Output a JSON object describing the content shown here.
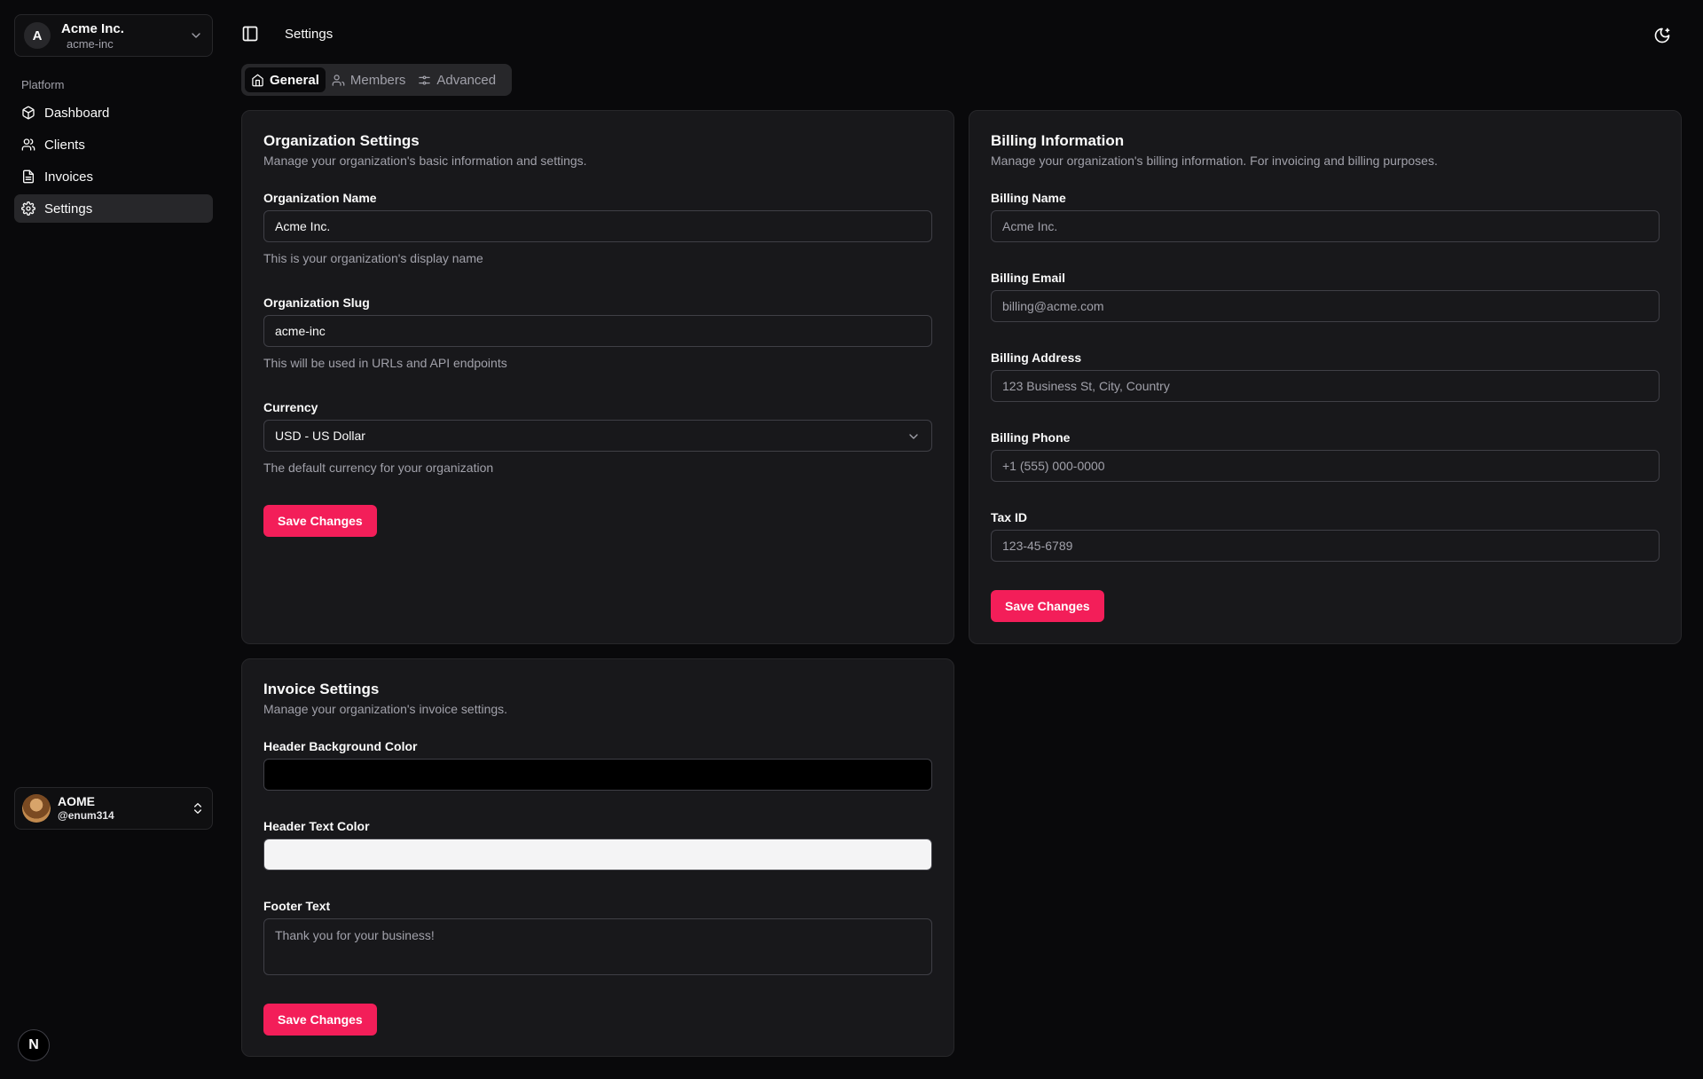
{
  "org": {
    "initial": "A",
    "name": "Acme Inc.",
    "slug": "acme-inc"
  },
  "sidebar": {
    "group_label": "Platform",
    "items": [
      {
        "label": "Dashboard",
        "icon": "box-icon"
      },
      {
        "label": "Clients",
        "icon": "users-icon"
      },
      {
        "label": "Invoices",
        "icon": "file-text-icon"
      },
      {
        "label": "Settings",
        "icon": "gear-icon",
        "active": true
      }
    ]
  },
  "user": {
    "name": "AOME",
    "handle": "@enum314"
  },
  "next_badge": "N",
  "header": {
    "title": "Settings"
  },
  "tabs": [
    {
      "label": "General",
      "icon": "home-icon",
      "active": true
    },
    {
      "label": "Members",
      "icon": "user-icon"
    },
    {
      "label": "Advanced",
      "icon": "sliders-icon"
    }
  ],
  "org_settings": {
    "title": "Organization Settings",
    "description": "Manage your organization's basic information and settings.",
    "name_label": "Organization Name",
    "name_value": "Acme Inc.",
    "name_help": "This is your organization's display name",
    "slug_label": "Organization Slug",
    "slug_value": "acme-inc",
    "slug_help": "This will be used in URLs and API endpoints",
    "currency_label": "Currency",
    "currency_value": "USD - US Dollar",
    "currency_help": "The default currency for your organization",
    "save_label": "Save Changes"
  },
  "billing": {
    "title": "Billing Information",
    "description": "Manage your organization's billing information. For invoicing and billing purposes.",
    "name_label": "Billing Name",
    "name_placeholder": "Acme Inc.",
    "email_label": "Billing Email",
    "email_placeholder": "billing@acme.com",
    "address_label": "Billing Address",
    "address_placeholder": "123 Business St, City, Country",
    "phone_label": "Billing Phone",
    "phone_placeholder": "+1 (555) 000-0000",
    "tax_label": "Tax ID",
    "tax_placeholder": "123-45-6789",
    "save_label": "Save Changes"
  },
  "invoice": {
    "title": "Invoice Settings",
    "description": "Manage your organization's invoice settings.",
    "header_bg_label": "Header Background Color",
    "header_bg_color": "#000000",
    "header_text_label": "Header Text Color",
    "header_text_color": "#f4f4f5",
    "footer_label": "Footer Text",
    "footer_placeholder": "Thank you for your business!",
    "save_label": "Save Changes"
  },
  "colors": {
    "accent": "#f31e59",
    "background": "#09090b",
    "card": "#18181b",
    "border": "#27272a"
  }
}
